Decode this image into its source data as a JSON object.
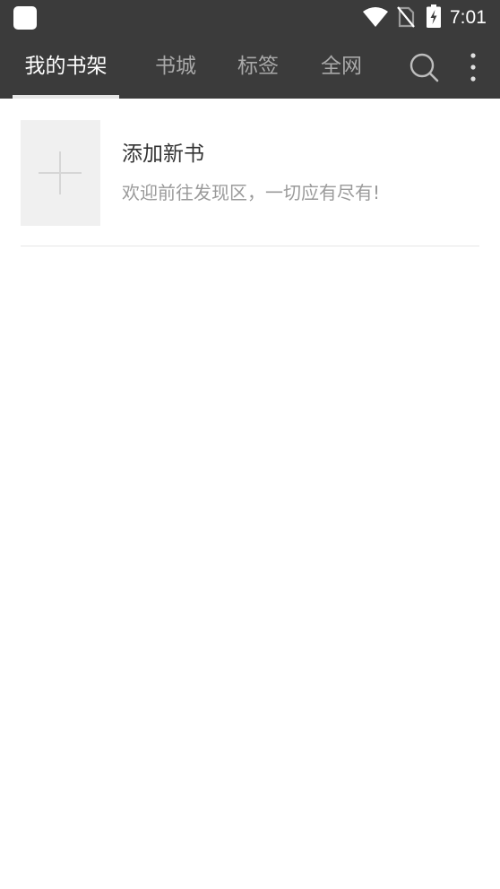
{
  "status_bar": {
    "time": "7:01",
    "icons": [
      "app-notification-icon",
      "wifi-icon",
      "no-sim-icon",
      "battery-charging-icon"
    ]
  },
  "app_bar": {
    "tabs": [
      {
        "label": "我的书架",
        "active": true
      },
      {
        "label": "书城",
        "active": false
      },
      {
        "label": "标签",
        "active": false
      },
      {
        "label": "全网",
        "active": false
      }
    ],
    "actions": [
      "search-icon",
      "more-vert-icon"
    ]
  },
  "shelf": {
    "add_item": {
      "title": "添加新书",
      "subtitle": "欢迎前往发现区，一切应有尽有!",
      "icon": "plus-icon"
    }
  },
  "colors": {
    "bar_background": "#3b3b3b",
    "tab_active": "#ffffff",
    "tab_inactive": "#a9a9a9",
    "cover_placeholder": "#f0f0f0",
    "subtitle": "#9a9a9a"
  }
}
